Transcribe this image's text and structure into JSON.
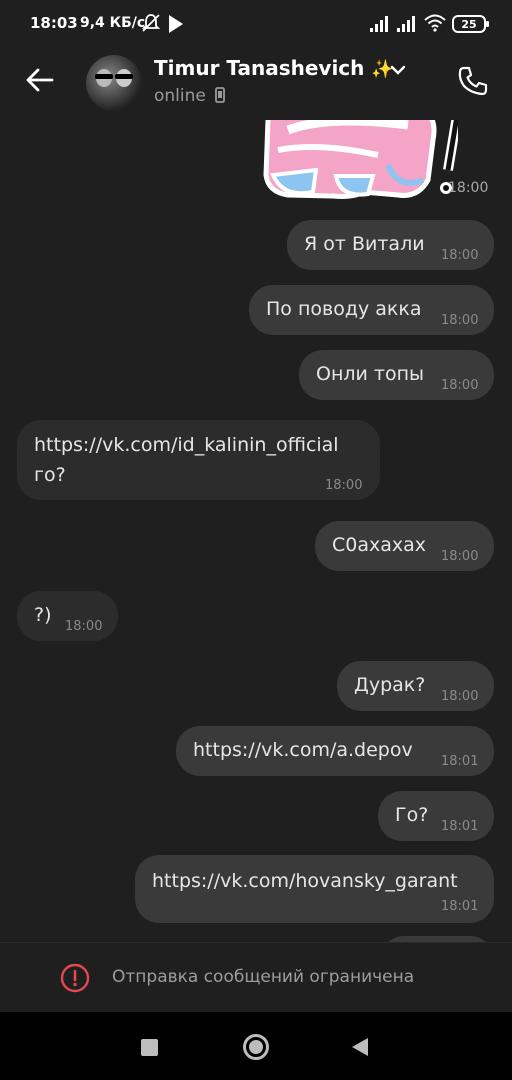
{
  "status_bar": {
    "time": "18:03",
    "speed": "9,4 КБ/с",
    "battery": "25"
  },
  "header": {
    "name": "Timur Tanashevich",
    "sparkle": "✨",
    "presence": "online"
  },
  "sticker": {
    "time": "18:00"
  },
  "messages": [
    {
      "dir": "out",
      "text": "Я от Витали",
      "time": "18:00"
    },
    {
      "dir": "out",
      "text": "По поводу акка",
      "time": "18:00"
    },
    {
      "dir": "out",
      "text": "Онли топы",
      "time": "18:00"
    },
    {
      "dir": "in",
      "link": "https://vk.com/id_kalinin_official",
      "text": "го?",
      "time": "18:00"
    },
    {
      "dir": "out",
      "text": "С0ахахах",
      "time": "18:00"
    },
    {
      "dir": "in",
      "text": "?)",
      "time": "18:00"
    },
    {
      "dir": "out",
      "text": "Дурак?",
      "time": "18:00"
    },
    {
      "dir": "out",
      "link": "https://vk.com/a.depov",
      "time": "18:01"
    },
    {
      "dir": "out",
      "text": "Го?",
      "time": "18:01"
    },
    {
      "dir": "out",
      "link": "https://vk.com/hovansky_garant",
      "time": "18:01"
    }
  ],
  "restricted": {
    "text": "Отправка сообщений ограничена"
  },
  "colors": {
    "link": "#5a9ee6",
    "bubble_out": "#3a3a3a",
    "bubble_in": "#2c2c2c",
    "warning": "#e5484d"
  },
  "icons": [
    "back-arrow-icon",
    "chevron-down-icon",
    "phone-icon",
    "warning-icon",
    "silent-bell-icon",
    "play-store-icon",
    "signal-icon",
    "wifi-icon"
  ]
}
